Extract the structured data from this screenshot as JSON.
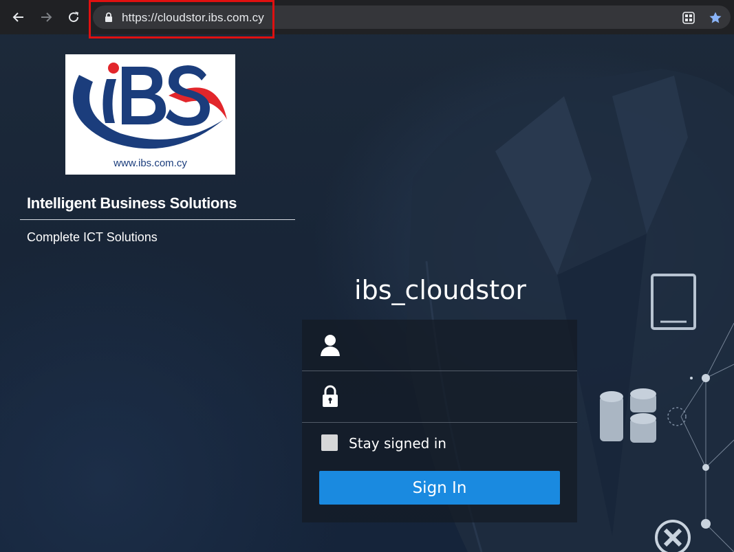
{
  "browser": {
    "url": "https://cloudstor.ibs.com.cy",
    "icons": [
      "back-arrow-icon",
      "forward-arrow-icon",
      "reload-icon",
      "lock-icon",
      "qr-code-icon",
      "bookmark-star-icon"
    ]
  },
  "branding": {
    "logo_text": "iBS",
    "logo_url": "www.ibs.com.cy",
    "title": "Intelligent Business Solutions",
    "subtitle": "Complete ICT Solutions"
  },
  "login": {
    "server_name": "ibs_cloudstor",
    "username_value": "",
    "password_value": "",
    "stay_signed_in_label": "Stay signed in",
    "stay_signed_in_checked": false,
    "sign_in_label": "Sign In"
  },
  "colors": {
    "accent": "#1a8ae0",
    "highlight_box": "#e01010",
    "logo_blue": "#1b3d7c",
    "logo_red": "#e2262b"
  }
}
